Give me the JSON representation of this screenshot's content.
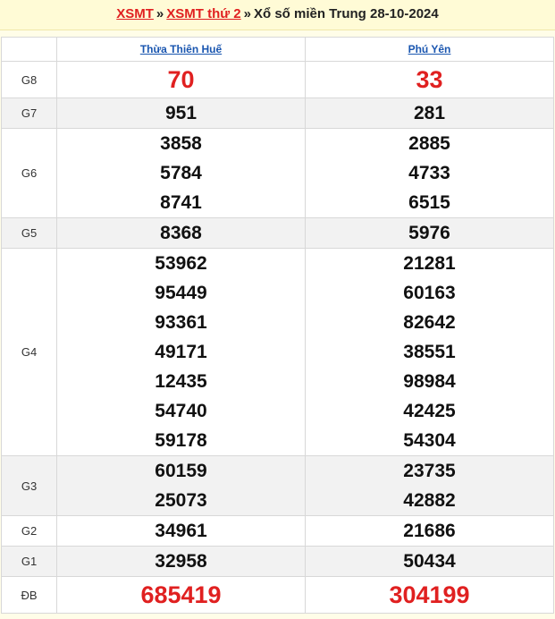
{
  "header": {
    "link1": "XSMT",
    "sep1": "»",
    "link2": "XSMT thứ 2",
    "sep2": "»",
    "title": "Xổ số miền Trung 28-10-2024"
  },
  "provinces": [
    "Thừa Thiên Huế",
    "Phú Yên"
  ],
  "rows": [
    {
      "prize": "G8",
      "values": [
        [
          "70"
        ],
        [
          "33"
        ]
      ]
    },
    {
      "prize": "G7",
      "values": [
        [
          "951"
        ],
        [
          "281"
        ]
      ]
    },
    {
      "prize": "G6",
      "values": [
        [
          "3858",
          "5784",
          "8741"
        ],
        [
          "2885",
          "4733",
          "6515"
        ]
      ]
    },
    {
      "prize": "G5",
      "values": [
        [
          "8368"
        ],
        [
          "5976"
        ]
      ]
    },
    {
      "prize": "G4",
      "values": [
        [
          "53962",
          "95449",
          "93361",
          "49171",
          "12435",
          "54740",
          "59178"
        ],
        [
          "21281",
          "60163",
          "82642",
          "38551",
          "98984",
          "42425",
          "54304"
        ]
      ]
    },
    {
      "prize": "G3",
      "values": [
        [
          "60159",
          "25073"
        ],
        [
          "23735",
          "42882"
        ]
      ]
    },
    {
      "prize": "G2",
      "values": [
        [
          "34961"
        ],
        [
          "21686"
        ]
      ]
    },
    {
      "prize": "G1",
      "values": [
        [
          "32958"
        ],
        [
          "50434"
        ]
      ]
    },
    {
      "prize": "ĐB",
      "values": [
        [
          "685419"
        ],
        [
          "304199"
        ]
      ]
    }
  ],
  "colors": {
    "highlight": "#e02020",
    "link": "#1a56b0",
    "alt_row": "#f2f2f2"
  }
}
